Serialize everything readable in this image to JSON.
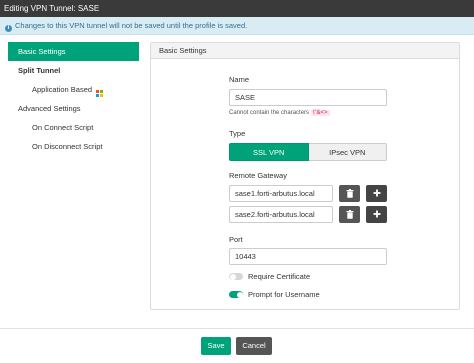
{
  "window": {
    "title": "Editing VPN Tunnel: SASE"
  },
  "info": {
    "message": "Changes to this VPN tunnel will not be saved until the profile is saved."
  },
  "sidebar": {
    "basic": "Basic Settings",
    "split": "Split Tunnel",
    "app_based": "Application Based",
    "advanced": "Advanced Settings",
    "on_connect": "On Connect Script",
    "on_disconnect": "On Disconnect Script"
  },
  "panel": {
    "header": "Basic Settings"
  },
  "form": {
    "name_label": "Name",
    "name_value": "SASE",
    "name_hint": "Cannot contain the characters",
    "name_hint_chars": "\\\"&<>",
    "type_label": "Type",
    "type_options": [
      "SSL VPN",
      "IPsec VPN"
    ],
    "type_selected": "SSL VPN",
    "gateway_label": "Remote Gateway",
    "gateways": [
      "sase1.forti-arbutus.local",
      "sase2.forti-arbutus.local"
    ],
    "port_label": "Port",
    "port_value": "10443",
    "require_cert_label": "Require Certificate",
    "require_cert": false,
    "prompt_user_label": "Prompt for Username",
    "prompt_user": true
  },
  "footer": {
    "save": "Save",
    "cancel": "Cancel"
  },
  "colors": {
    "accent": "#00a379",
    "info_bg": "#d9ecf4",
    "titlebar": "#3a3a3a"
  },
  "icons": [
    "info-icon",
    "windows-logo-icon",
    "trash-icon",
    "plus-icon"
  ]
}
